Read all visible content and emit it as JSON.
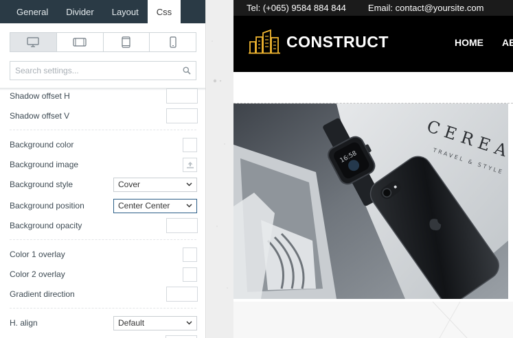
{
  "panel": {
    "tabs": [
      {
        "label": "General",
        "active": false
      },
      {
        "label": "Divider",
        "active": false
      },
      {
        "label": "Layout",
        "active": false
      },
      {
        "label": "Css",
        "active": true
      }
    ],
    "devices": [
      "desktop-icon",
      "tablet-landscape-icon",
      "tablet-portrait-icon",
      "mobile-icon"
    ],
    "search": {
      "placeholder": "Search settings..."
    },
    "settings": {
      "shadow_offset_h": "Shadow offset H",
      "shadow_offset_v": "Shadow offset V",
      "background_color": "Background color",
      "background_image": "Background image",
      "background_style": {
        "label": "Background style",
        "value": "Cover"
      },
      "background_position": {
        "label": "Background position",
        "value": "Center Center"
      },
      "background_opacity": "Background opacity",
      "color1_overlay": "Color 1 overlay",
      "color2_overlay": "Color 2 overlay",
      "gradient_direction": "Gradient direction",
      "h_align": {
        "label": "H. align",
        "value": "Default"
      }
    },
    "colors": {
      "tabbar": "#2a3a45",
      "focus": "#2b5e87"
    }
  },
  "preview": {
    "topbar": {
      "phone": "Tel: (+065) 9584 884 844",
      "email": "Email: contact@yoursite.com"
    },
    "brand": "CONSTRUCT",
    "nav": [
      "HOME",
      "AB"
    ],
    "colors": {
      "logo_accent": "#f2b731",
      "header": "#000000"
    },
    "photo_text": {
      "magazine": "CEREAL",
      "magazine_sub": "TRAVEL & STYLE",
      "watch": "16:58"
    }
  }
}
